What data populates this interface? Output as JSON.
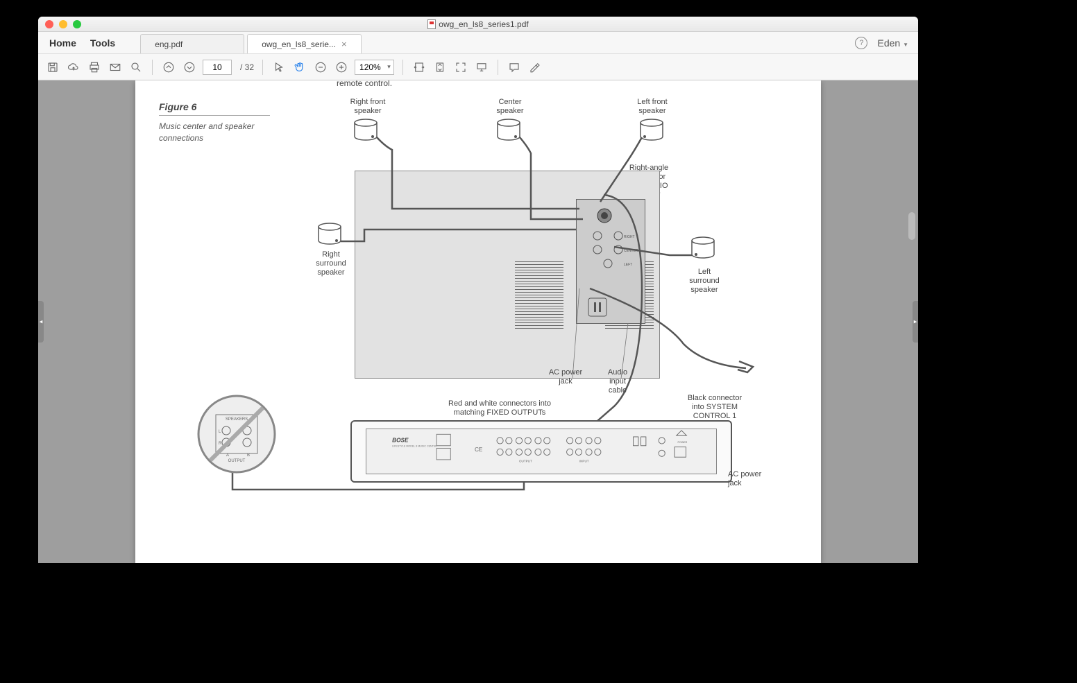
{
  "window": {
    "title": "owg_en_ls8_series1.pdf"
  },
  "menu": {
    "home": "Home",
    "tools": "Tools",
    "user": "Eden"
  },
  "tabs": [
    {
      "label": "eng.pdf",
      "active": false,
      "closable": false
    },
    {
      "label": "owg_en_ls8_serie...",
      "active": true,
      "closable": true
    }
  ],
  "toolbar": {
    "page_current": "10",
    "page_total": "/ 32",
    "zoom": "120%"
  },
  "document": {
    "cutoff_top": "remote control.",
    "figure_num": "Figure 6",
    "figure_caption": "Music center and speaker connections",
    "labels": {
      "right_front": "Right front\nspeaker",
      "center": "Center\nspeaker",
      "left_front": "Left front\nspeaker",
      "right_surround": "Right\nsurround\nspeaker",
      "left_surround": "Left\nsurround\nspeaker",
      "right_angle": "Right-angle\nconnector\ninto AUDIO\nINPUT",
      "ac_jack": "AC power\njack",
      "audio_cable": "Audio\ninput\ncable",
      "red_white": "Red and white connectors into\nmatching FIXED OUTPUTs",
      "black_conn": "Black connector\ninto SYSTEM\nCONTROL 1",
      "ac_jack2": "AC power\njack",
      "prohibit_speakers": "SPEAKERS",
      "prohibit_output": "OUTPUT",
      "bose": "BOSE"
    }
  }
}
